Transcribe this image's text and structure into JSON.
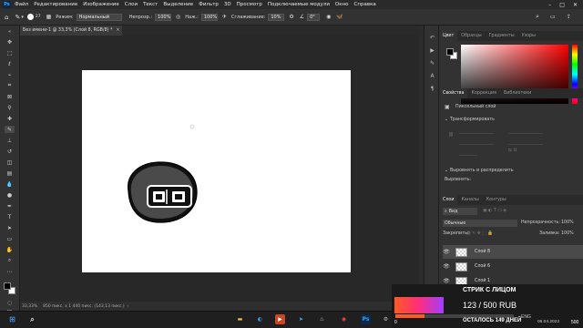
{
  "menubar": {
    "app_logo": "Ps",
    "items": [
      "Файл",
      "Редактирование",
      "Изображение",
      "Слои",
      "Текст",
      "Выделение",
      "Фильтр",
      "3D",
      "Просмотр",
      "Подключаемые модули",
      "Окно",
      "Справка"
    ],
    "window_controls": [
      "–",
      "□",
      "✕"
    ]
  },
  "options": {
    "brush_size": "27",
    "mode_label": "Режим:",
    "mode_value": "Нормальный",
    "opacity_label": "Непрозр.:",
    "opacity_value": "100%",
    "flow_label": "Наж.:",
    "flow_value": "100%",
    "smoothing_label": "Сглаживание:",
    "smoothing_value": "10%",
    "angle_value": "0°"
  },
  "document": {
    "tab_title": "Без имени-1 @ 33,3% (Слой 8, RGB/8) *",
    "close": "×"
  },
  "status": {
    "zoom": "33,33%",
    "info": "850 пикс. х 1 440 пикс. (143,13 пикс.)"
  },
  "color_panel": {
    "tabs": [
      "Цвет",
      "Образцы",
      "Градиенты",
      "Узоры"
    ]
  },
  "properties_panel": {
    "tabs": [
      "Свойства",
      "Коррекция",
      "Библиотеки"
    ],
    "layer_type": "Пиксельный слой",
    "transform_label": "Трансформировать",
    "align_label": "Выровнять и распределить",
    "align_sub": "Выровнять:"
  },
  "layers_panel": {
    "tabs": [
      "Слои",
      "Каналы",
      "Контуры"
    ],
    "filter_label": "Вид",
    "blend_mode": "Обычные",
    "opacity_label": "Непрозрачность:",
    "opacity_value": "100%",
    "lock_label": "Закрепить:",
    "fill_label": "Заливка:",
    "fill_value": "100%",
    "layers": [
      "Слой 8",
      "Слой 6",
      "Слой 1"
    ]
  },
  "overlay": {
    "title": "СТРИК С ЛИЦОМ",
    "amount": "123 / 500 RUB",
    "progress": 0.246,
    "progress_min": "0",
    "progress_max": "500",
    "days_left": "ОСТАЛОСЬ 149 ДНЕЙ"
  },
  "taskbar": {
    "lang": "ENG",
    "date": "06.04.2023"
  },
  "colors": {
    "foreground": "#000000",
    "background": "#ffffff",
    "hue": "#ff0000",
    "accent": "#31a8ff"
  }
}
